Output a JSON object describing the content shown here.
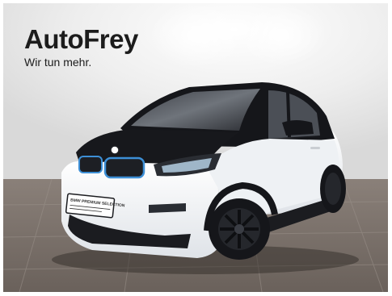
{
  "brand": {
    "name": "AutoFrey",
    "tagline": "Wir tun mehr."
  },
  "plate": {
    "text": "BMW PREMIUM SELECTION"
  },
  "colors": {
    "wall": "#f2f2f2",
    "floor": "#7a7068",
    "body": "#f4f6f8",
    "roof": "#151619",
    "accent": "#3d8fd6",
    "brand_text": "#1c1c1c"
  },
  "scene": {
    "subject": "car-icon",
    "setting": "showroom"
  }
}
